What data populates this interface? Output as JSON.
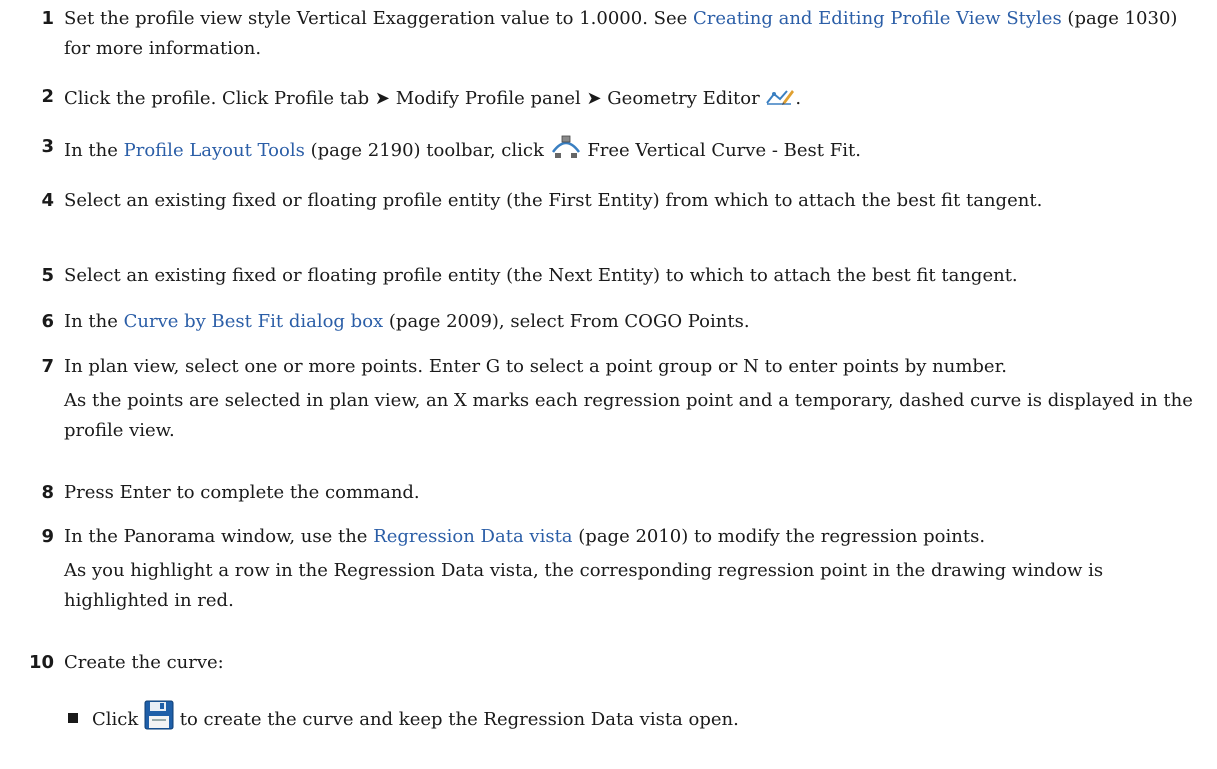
{
  "steps": [
    {
      "num": "1",
      "parts": [
        "Set the profile view style Vertical Exaggeration value to 1.0000. See ",
        "Creating and Editing Profile View Styles",
        " (page 1030) for more information."
      ]
    },
    {
      "num": "2",
      "parts": [
        "Click the profile. Click Profile tab ➤ Modify Profile panel ➤ Geometry Editor ",
        "."
      ],
      "icon": "geometry-editor-icon"
    },
    {
      "num": "3",
      "parts": [
        "In the ",
        "Profile Layout Tools",
        " (page 2190) toolbar, click ",
        " Free Vertical Curve - Best Fit."
      ],
      "icon": "free-vertical-curve-best-fit-icon"
    },
    {
      "num": "4",
      "parts": [
        "Select an existing fixed or floating profile entity (the First Entity) from which to attach the best fit tangent."
      ]
    },
    {
      "num": "5",
      "parts": [
        "Select an existing fixed or floating profile entity (the Next Entity) to which to attach the best fit tangent."
      ]
    },
    {
      "num": "6",
      "parts": [
        "In the ",
        "Curve by Best Fit dialog box",
        " (page 2009), select From COGO Points."
      ]
    },
    {
      "num": "7",
      "parts": [
        "In plan view, select one or more points. Enter G to select a point group or N to enter points by number."
      ],
      "note": "As the points are selected in plan view, an X marks each regression point and a temporary, dashed curve is displayed in the profile view."
    },
    {
      "num": "8",
      "parts": [
        "Press Enter to complete the command."
      ]
    },
    {
      "num": "9",
      "parts": [
        "In the Panorama window, use the ",
        "Regression Data vista",
        " (page 2010) to modify the regression points."
      ],
      "note": "As you highlight a row in the Regression Data vista, the corresponding regression point in the drawing window is highlighted in red."
    },
    {
      "num": "10",
      "parts": [
        "Create the curve:"
      ]
    }
  ],
  "subitem": {
    "before": "Click ",
    "after": " to create the curve and keep the Regression Data vista open.",
    "icon": "save-icon"
  },
  "colors": {
    "link": "#2b5ea7",
    "text": "#1a1a1a"
  }
}
